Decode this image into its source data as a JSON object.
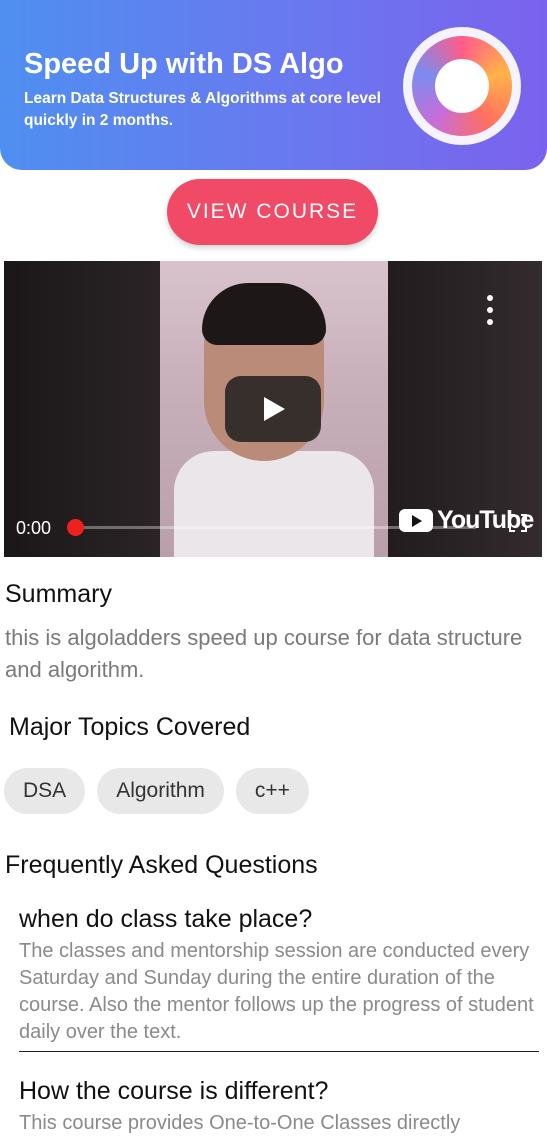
{
  "banner": {
    "title": "Speed Up with DS Algo",
    "subtitle": "Learn Data Structures & Algorithms at core level quickly in 2 months."
  },
  "cta": {
    "label": "VIEW COURSE"
  },
  "video": {
    "time": "0:00",
    "progress": 0,
    "brand": "YouTube"
  },
  "summary": {
    "heading": "Summary",
    "text": "this is algoladders speed up course for data structure and algorithm."
  },
  "topics": {
    "heading": "Major Topics Covered",
    "items": [
      "DSA",
      "Algorithm",
      "c++"
    ]
  },
  "faq": {
    "heading": "Frequently Asked Questions",
    "items": [
      {
        "question": "when do class take place?",
        "answer": "The classes and mentorship session are conducted every Saturday and Sunday during the entire duration of the course. Also the mentor follows up the progress of student daily over the text."
      },
      {
        "question": "How the course is different?",
        "answer": "This course provides One-to-One Classes directly"
      }
    ]
  },
  "colors": {
    "banner_start": "#4f8ff0",
    "banner_end": "#7b62ee",
    "cta": "#f04a66",
    "progress_knob": "#f0201f"
  }
}
